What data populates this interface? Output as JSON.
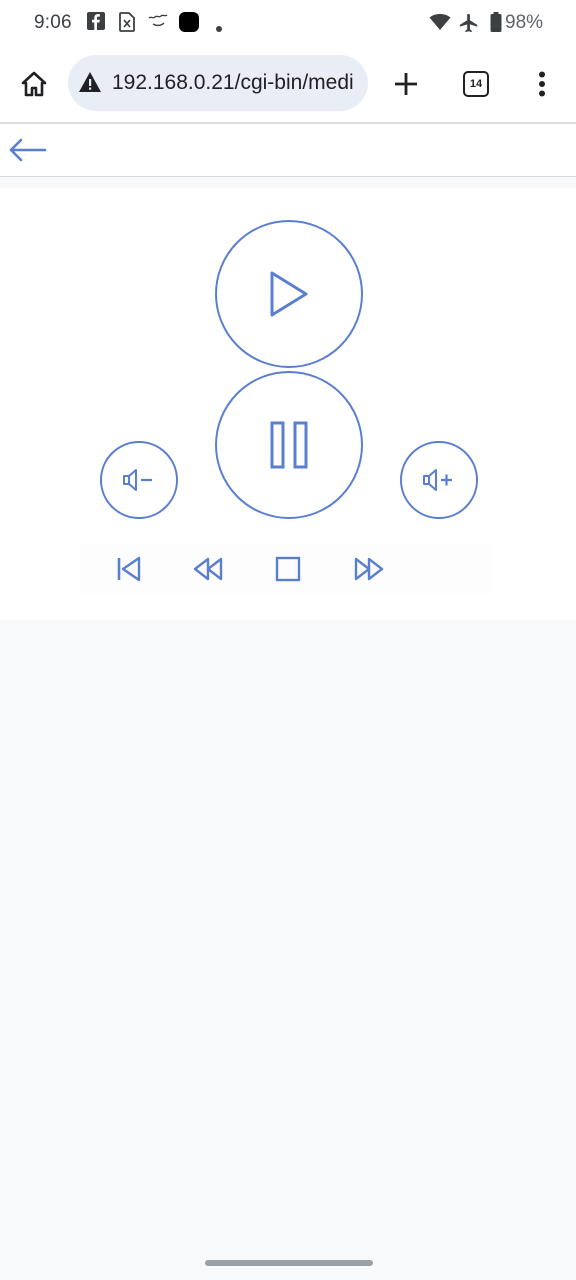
{
  "status_bar": {
    "time": "9:06",
    "battery_percent": "98%",
    "icons": [
      "facebook-icon",
      "sim-icon",
      "notification-app-icon",
      "app-badge-icon",
      "dot-icon",
      "wifi-icon",
      "airplane-mode-icon",
      "battery-icon"
    ]
  },
  "browser": {
    "url": "192.168.0.21/cgi-bin/medi",
    "tab_count": "14",
    "icons": {
      "home": "home-icon",
      "security": "not-secure-warning-icon",
      "new_tab": "plus-icon",
      "menu": "more-vertical-icon"
    }
  },
  "app": {
    "back_icon": "arrow-left-icon",
    "accent_color": "#5b7fd0",
    "controls": {
      "play": "play-icon",
      "pause": "pause-icon",
      "volume_down": "volume-down-icon",
      "volume_up": "volume-up-icon",
      "transport": [
        "skip-previous-icon",
        "rewind-icon",
        "stop-icon",
        "fast-forward-icon"
      ]
    }
  }
}
